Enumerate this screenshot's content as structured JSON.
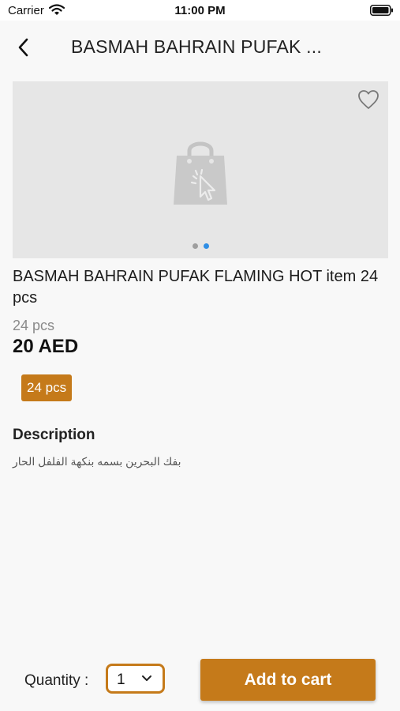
{
  "status_bar": {
    "carrier": "Carrier",
    "time": "11:00 PM",
    "icons": [
      "wifi-icon",
      "battery-icon"
    ]
  },
  "header": {
    "back_icon": "chevron-left-icon",
    "title": "BASMAH BAHRAIN PUFAK ..."
  },
  "gallery": {
    "placeholder_icon": "shopping-bag-cursor-icon",
    "favorite_icon": "heart-outline-icon",
    "slide_count": 2,
    "active_slide": 2
  },
  "product": {
    "title": "BASMAH BAHRAIN PUFAK FLAMING HOT item 24 pcs",
    "pack_size": "24 pcs",
    "price": "20 AED",
    "variant_chip": "24 pcs"
  },
  "description": {
    "heading": "Description",
    "text": "بفك البحرين بسمه بنكهة الفلفل الحار"
  },
  "footer": {
    "quantity_label": "Quantity :",
    "quantity_value": "1",
    "add_to_cart_label": "Add to cart"
  },
  "colors": {
    "accent": "#c57a1a",
    "active_dot": "#2f8ee5",
    "image_bg": "#e6e6e6",
    "page_bg": "#f8f8f8"
  }
}
